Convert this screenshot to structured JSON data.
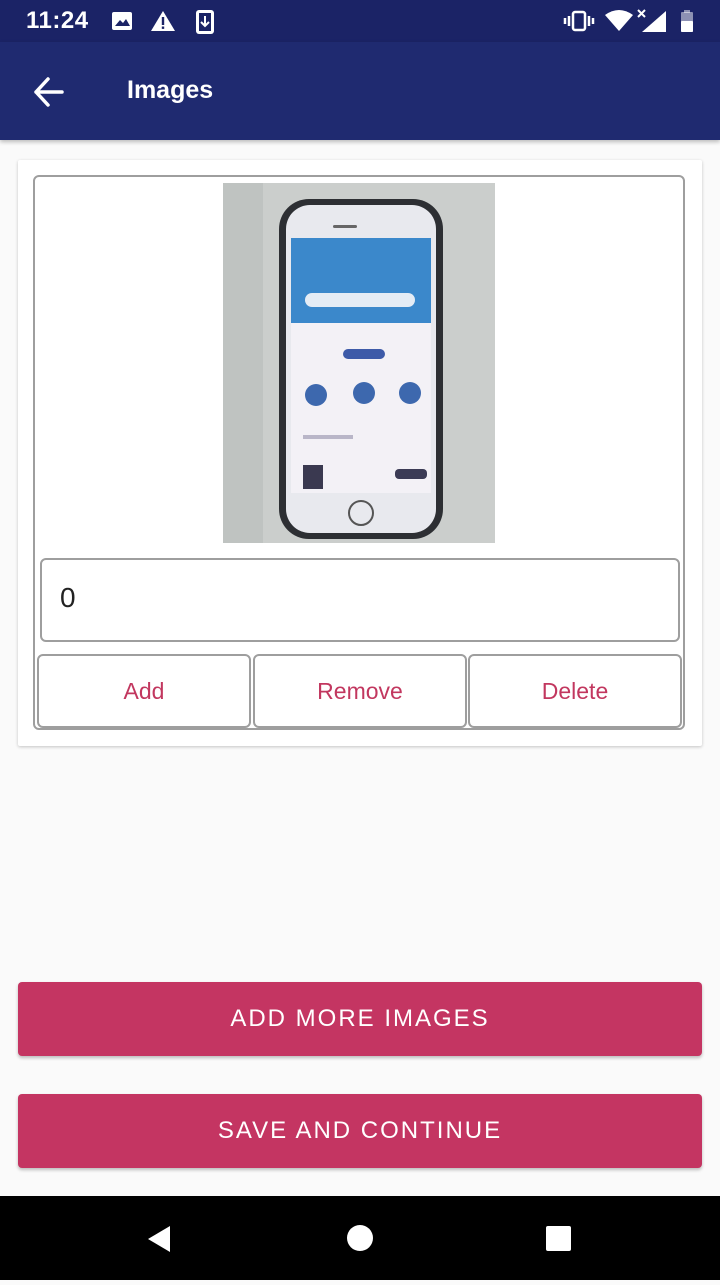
{
  "status_bar": {
    "time": "11:24",
    "icons": [
      "image-icon",
      "warning-icon",
      "download-icon",
      "vibrate-icon",
      "wifi-icon",
      "signal-icon",
      "battery-icon"
    ]
  },
  "app_bar": {
    "title": "Images",
    "back_icon": "arrow-left-icon"
  },
  "image_card": {
    "field_value": "0",
    "buttons": {
      "add": "Add",
      "remove": "Remove",
      "delete": "Delete"
    }
  },
  "actions": {
    "add_more": "ADD MORE IMAGES",
    "save_continue": "SAVE AND CONTINUE"
  },
  "nav_bar": [
    "back-icon",
    "home-icon",
    "recents-icon"
  ],
  "colors": {
    "status_bar": "#1b2366",
    "app_bar": "#1f2a70",
    "accent": "#c43562",
    "button_text": "#c2375f"
  }
}
